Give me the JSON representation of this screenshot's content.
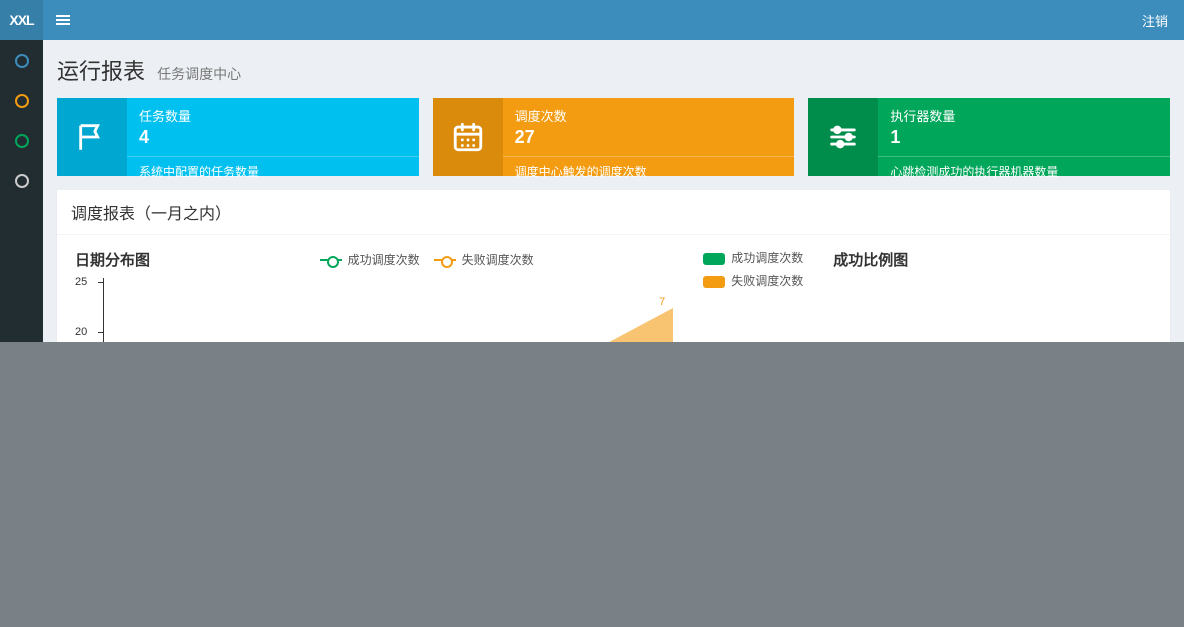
{
  "brand": "XXL",
  "topbar": {
    "logout": "注销"
  },
  "sidebar": {
    "items": [
      {
        "color": "#3c8dbc"
      },
      {
        "color": "#f39c12"
      },
      {
        "color": "#00a65a"
      },
      {
        "color": "#ccc"
      }
    ]
  },
  "page": {
    "title": "运行报表",
    "subtitle": "任务调度中心"
  },
  "cards": [
    {
      "label": "任务数量",
      "value": "4",
      "desc": "系统中配置的任务数量",
      "icon": "flag"
    },
    {
      "label": "调度次数",
      "value": "27",
      "desc": "调度中心触发的调度次数",
      "icon": "calendar"
    },
    {
      "label": "执行器数量",
      "value": "1",
      "desc": "心跳检测成功的执行器机器数量",
      "icon": "sliders"
    }
  ],
  "panel": {
    "title": "调度报表（一月之内）"
  },
  "charts": {
    "line": {
      "title": "日期分布图",
      "legend": {
        "success": "成功调度次数",
        "fail": "失败调度次数"
      },
      "yticks": {
        "t25": "25",
        "t20": "20"
      },
      "peak_label": "7"
    },
    "pie": {
      "title": "成功比例图",
      "legend": {
        "success": "成功调度次数",
        "fail": "失败调度次数"
      }
    }
  },
  "colors": {
    "success": "#00a65a",
    "fail": "#f39c12"
  },
  "chart_data": {
    "type": "line",
    "title": "日期分布图",
    "ylabel": "",
    "xlabel": "",
    "ylim": [
      0,
      25
    ],
    "series": [
      {
        "name": "成功调度次数",
        "values": []
      },
      {
        "name": "失败调度次数",
        "values": [
          7
        ]
      }
    ],
    "pie": {
      "type": "pie",
      "title": "成功比例图",
      "series": [
        {
          "name": "成功调度次数"
        },
        {
          "name": "失败调度次数"
        }
      ]
    }
  }
}
